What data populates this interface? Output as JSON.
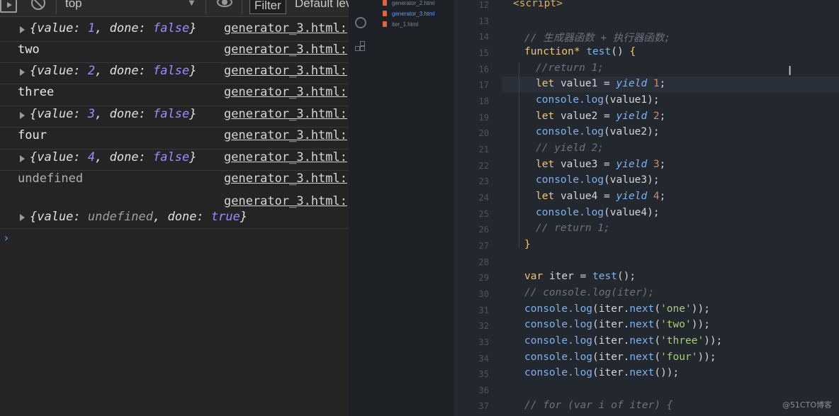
{
  "console": {
    "toolbar": {
      "context": "top",
      "filter_label": "Filter",
      "levels_label": "Default lev"
    },
    "source_file": "generator_3.html:",
    "rows": [
      {
        "kind": "object",
        "value": "1",
        "done": "false"
      },
      {
        "kind": "log",
        "text": "two"
      },
      {
        "kind": "object",
        "value": "2",
        "done": "false"
      },
      {
        "kind": "log",
        "text": "three"
      },
      {
        "kind": "object",
        "value": "3",
        "done": "false"
      },
      {
        "kind": "log",
        "text": "four"
      },
      {
        "kind": "object",
        "value": "4",
        "done": "false"
      },
      {
        "kind": "log",
        "text": "undefined"
      },
      {
        "kind": "object-final",
        "value": "undefined",
        "done": "true"
      }
    ],
    "labels": {
      "open": "{value: ",
      "sep": ", done: ",
      "close": "}"
    },
    "prompt": "›"
  },
  "editor": {
    "files": [
      {
        "name": "generator_2.html",
        "active": false
      },
      {
        "name": "generator_3.html",
        "active": true
      },
      {
        "name": "iter_1.html",
        "active": false
      }
    ],
    "line_numbers": [
      "12",
      "13",
      "14",
      "15",
      "16",
      "17",
      "18",
      "19",
      "20",
      "21",
      "22",
      "23",
      "24",
      "25",
      "26",
      "27",
      "28",
      "29",
      "30",
      "31",
      "32",
      "33",
      "34",
      "35",
      "36",
      "37"
    ],
    "code": {
      "l12": "<script>",
      "l14": "// 生成器函数 + 执行器函数;",
      "l15_kw": "function*",
      "l15_fn": "test",
      "l16": "//return 1;",
      "let": "let",
      "yield": "yield",
      "console_log": "console.log",
      "value1": "value1",
      "value2": "value2",
      "value3": "value3",
      "value4": "value4",
      "n1": "1",
      "n2": "2",
      "n3": "3",
      "n4": "4",
      "l21": "// yield 2;",
      "l26": "// return 1;",
      "l29_kw": "var",
      "l29_rest": "iter = ",
      "l29_fn": "test",
      "l30": "// console.log(iter);",
      "s_one": "'one'",
      "s_two": "'two'",
      "s_three": "'three'",
      "s_four": "'four'",
      "l37": "// for (var i of iter) {"
    },
    "watermark": "@51CTO博客"
  }
}
